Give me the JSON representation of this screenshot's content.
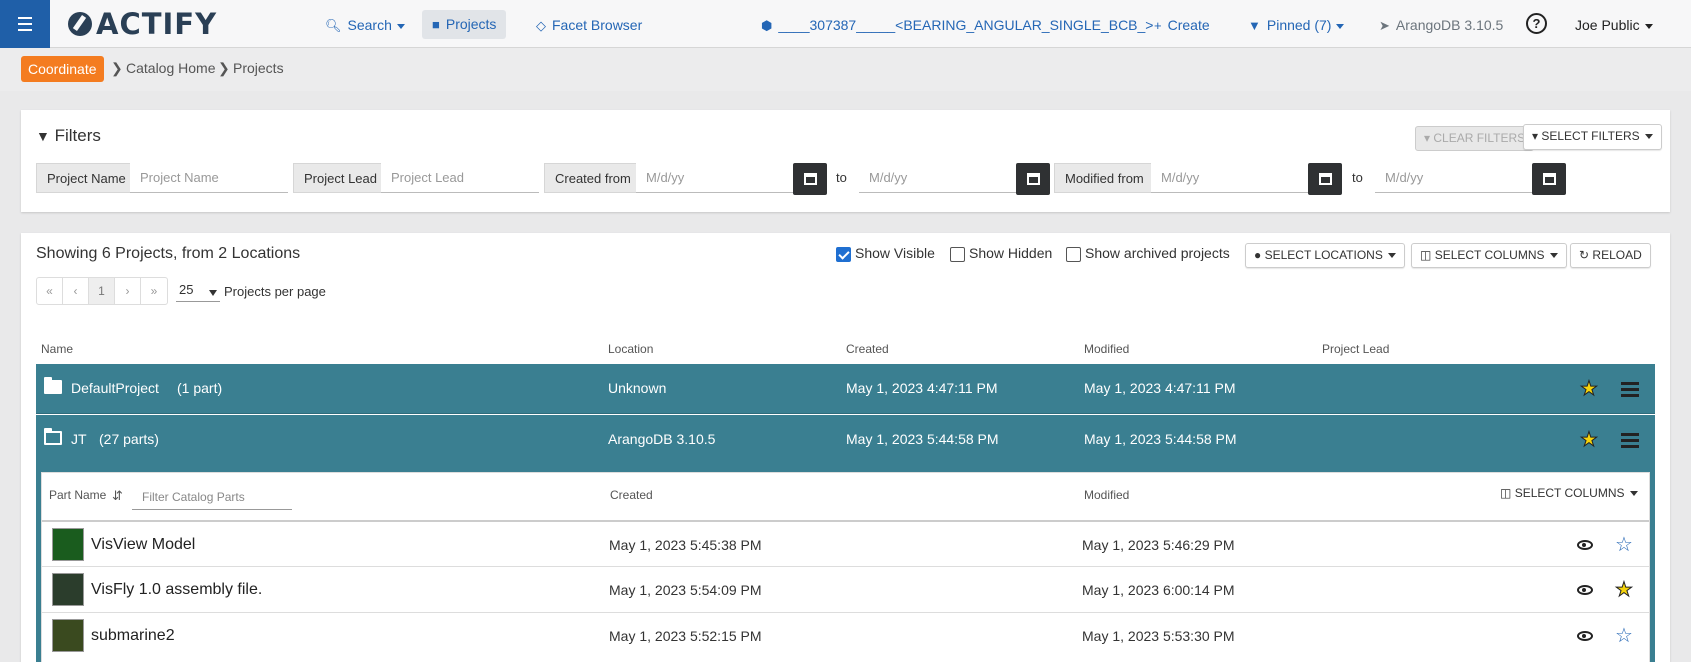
{
  "topnav": {
    "logo_text": "ACTIFY",
    "search": "Search",
    "projects": "Projects",
    "facet_browser": "Facet Browser",
    "current_part": "____307387_____<BEARING_ANGULAR_SINGLE_BCB_>",
    "create": "Create",
    "pinned": "Pinned (7)",
    "version": "ArangoDB 3.10.5",
    "help": "?",
    "user": "Joe Public"
  },
  "breadcrumb": {
    "coordinate": "Coordinate",
    "items": [
      "Catalog Home",
      "Projects"
    ]
  },
  "filters": {
    "title": "Filters",
    "clear": "CLEAR FILTERS",
    "select": "SELECT FILTERS",
    "project_name_label": "Project Name",
    "project_name_placeholder": "Project Name",
    "project_lead_label": "Project Lead",
    "project_lead_placeholder": "Project Lead",
    "created_from_label": "Created from",
    "modified_from_label": "Modified from",
    "date_placeholder": "M/d/yy",
    "to": "to"
  },
  "projects": {
    "showing": "Showing 6 Projects, from 2 Locations",
    "show_visible": "Show Visible",
    "show_hidden": "Show Hidden",
    "show_archived": "Show archived projects",
    "select_locations": "SELECT LOCATIONS",
    "select_columns": "SELECT COLUMNS",
    "reload": "RELOAD",
    "pager": [
      "«",
      "‹",
      "1",
      "›",
      "»"
    ],
    "per_page": "25",
    "per_page_label": "Projects per page",
    "columns": [
      "Name",
      "Location",
      "Created",
      "Modified",
      "Project Lead"
    ],
    "rows": [
      {
        "name": "DefaultProject",
        "count": "(1 part)",
        "location": "Unknown",
        "created": "May 1, 2023 4:47:11 PM",
        "modified": "May 1, 2023 4:47:11 PM",
        "lead": ""
      },
      {
        "name": "JT",
        "count": "(27 parts)",
        "location": "ArangoDB 3.10.5",
        "created": "May 1, 2023 5:44:58 PM",
        "modified": "May 1, 2023 5:44:58 PM",
        "lead": ""
      }
    ]
  },
  "parts": {
    "part_name_header": "Part Name",
    "filter_placeholder": "Filter Catalog Parts",
    "created_header": "Created",
    "modified_header": "Modified",
    "select_columns": "SELECT COLUMNS",
    "rows": [
      {
        "name": "VisView Model",
        "created": "May 1, 2023 5:45:38 PM",
        "modified": "May 1, 2023 5:46:29 PM",
        "pinned": false
      },
      {
        "name": "VisFly 1.0 assembly file.",
        "created": "May 1, 2023 5:54:09 PM",
        "modified": "May 1, 2023 6:00:14 PM",
        "pinned": true
      },
      {
        "name": "submarine2",
        "created": "May 1, 2023 5:52:15 PM",
        "modified": "May 1, 2023 5:53:30 PM",
        "pinned": false
      }
    ]
  },
  "colors": {
    "brand_blue": "#1f5fa8",
    "link_blue": "#2466b5",
    "coordinate_orange": "#f47c20",
    "row_teal": "#3a7f91",
    "star_yellow": "#f5d30b"
  }
}
